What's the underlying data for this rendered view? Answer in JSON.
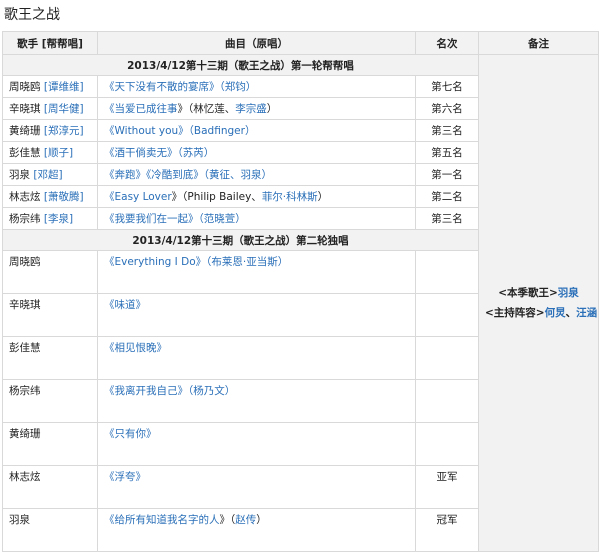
{
  "title": "歌王之战",
  "headers": {
    "singer": "歌手 [帮帮唱]",
    "song": "曲目（原唱）",
    "rank": "名次",
    "notes": "备注"
  },
  "round1": {
    "title": "2013/4/12第十三期（歌王之战）第一轮帮帮唱",
    "rows": [
      {
        "singer": "周晓鸥",
        "helper": "谭维维",
        "song_open": "《",
        "song": "天下没有不散的宴席",
        "song_close": "》（",
        "orig": "郑钧",
        "tail": "）",
        "rank": "第七名"
      },
      {
        "singer": "辛晓琪",
        "helper": "周华健",
        "song_open": "《",
        "song": "当爱已成往事",
        "song_close": "》（林忆莲、",
        "orig": "李宗盛",
        "tail": "）",
        "rank": "第六名"
      },
      {
        "singer": "黄绮珊",
        "helper": "郑淳元",
        "song_open": "《",
        "song": "Without you",
        "song_close": "》（",
        "orig": "Badfinger",
        "tail": "）",
        "rank": "第三名"
      },
      {
        "singer": "彭佳慧",
        "helper": "顺子",
        "song_open": "《",
        "song": "酒干倘卖无",
        "song_close": "》（",
        "orig": "苏芮",
        "tail": "）",
        "rank": "第五名"
      },
      {
        "singer": "羽泉",
        "helper": "邓超",
        "song_open": "《",
        "song": "奔跑",
        "song_close": "》",
        "song2": "冷酷到底",
        "song2_close": "》（",
        "orig": "黄征",
        "tail": "、羽泉）",
        "rank": "第一名"
      },
      {
        "singer": "林志炫",
        "helper": "萧敬腾",
        "song_open": "《",
        "song": "Easy Lover",
        "song_close": "》（Philip Bailey、",
        "orig": "菲尔·科林斯",
        "tail": "）",
        "rank": "第二名"
      },
      {
        "singer": "杨宗纬",
        "helper": "李泉",
        "song_open": "《",
        "song": "我要我们在一起",
        "song_close": "》（",
        "orig": "范晓萱",
        "tail": "）",
        "rank": "第三名"
      }
    ]
  },
  "round2": {
    "title": "2013/4/12第十三期（歌王之战）第二轮独唱",
    "rows": [
      {
        "singer": "周晓鸥",
        "song_open": "《",
        "song": "Everything I Do",
        "song_close": "》（",
        "orig": "布莱恩·亚当斯",
        "tail": "）",
        "rank": ""
      },
      {
        "singer": "辛晓琪",
        "song_open": "《",
        "song": "味道",
        "song_close": "》",
        "orig": "",
        "tail": "",
        "rank": ""
      },
      {
        "singer": "彭佳慧",
        "song_open": "《",
        "song": "相见恨晚",
        "song_close": "》",
        "orig": "",
        "tail": "",
        "rank": ""
      },
      {
        "singer": "杨宗纬",
        "song_open": "《",
        "song": "我离开我自己",
        "song_close": "》（",
        "orig": "杨乃文",
        "tail": "）",
        "rank": ""
      },
      {
        "singer": "黄绮珊",
        "song_open": "《",
        "song": "只有你",
        "song_close": "》",
        "orig": "",
        "tail": "",
        "rank": ""
      },
      {
        "singer": "林志炫",
        "song_open": "《",
        "song": "浮夸",
        "song_close": "》",
        "orig": "",
        "tail": "",
        "rank": "亚军"
      },
      {
        "singer": "羽泉",
        "song_open": "《",
        "song": "给所有知道我名字的人",
        "song_close": "》（",
        "orig": "赵传",
        "tail": "）",
        "rank": "冠军"
      }
    ]
  },
  "notes": {
    "line1_prefix": "<本季歌王>",
    "line1_link": "羽泉",
    "line2_prefix": "<主持阵容>",
    "line2_link1": "何炅",
    "line2_sep": "、",
    "line2_link2": "汪涵"
  }
}
